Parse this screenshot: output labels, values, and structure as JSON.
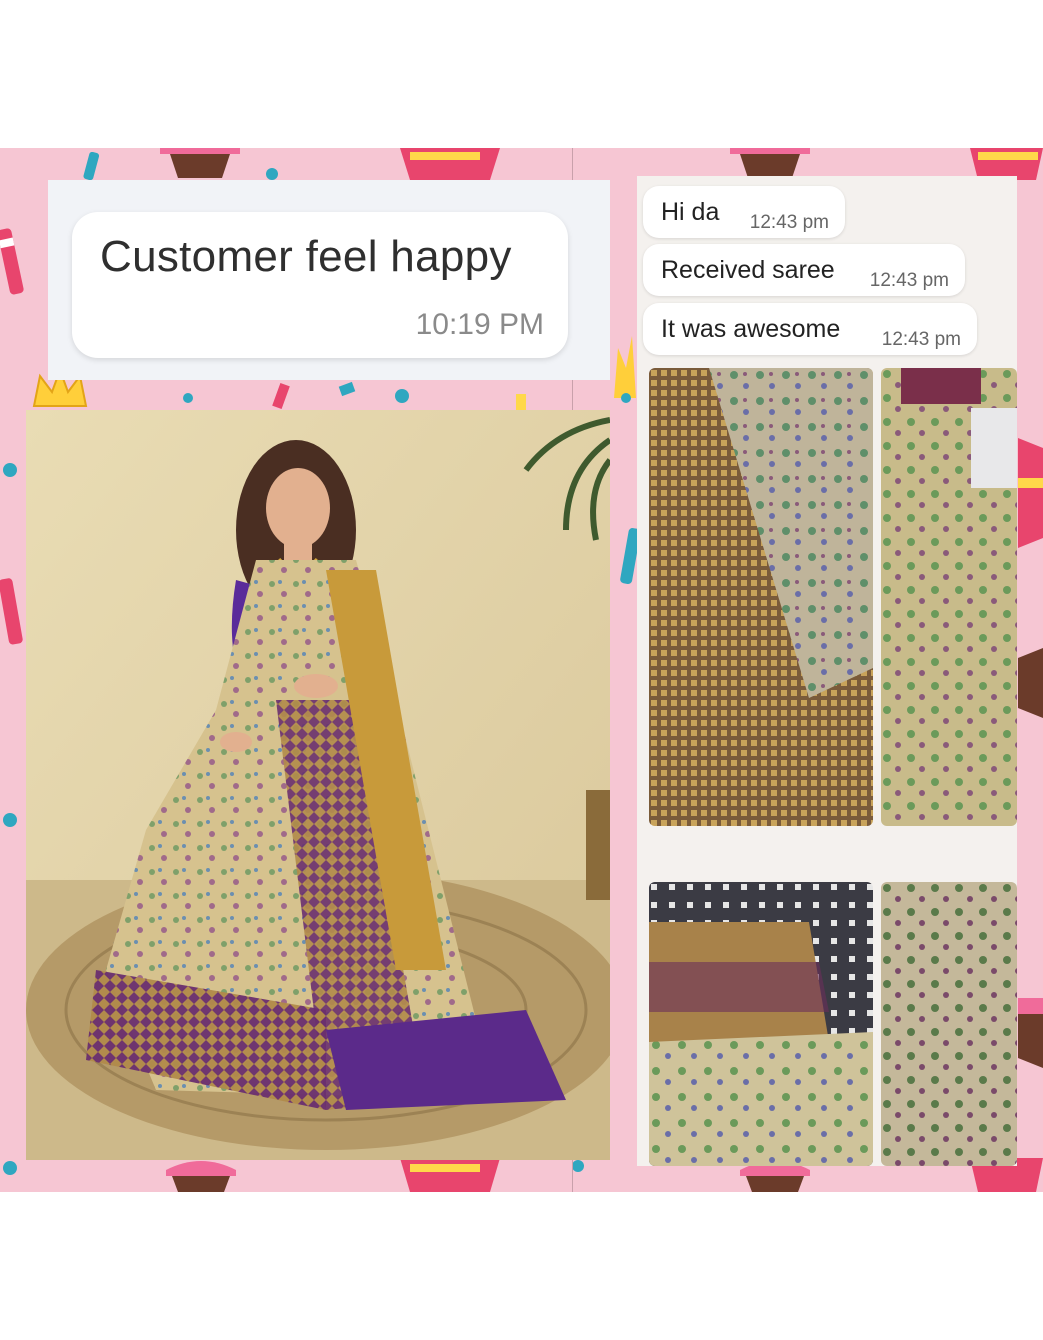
{
  "left_chat": {
    "message": "Customer feel happy",
    "time": "10:19 PM"
  },
  "right_chat": {
    "messages": [
      {
        "text": "Hi da",
        "time": "12:43 pm"
      },
      {
        "text": "Received saree",
        "time": "12:43 pm"
      },
      {
        "text": "It was awesome",
        "time": "12:43 pm"
      }
    ]
  },
  "colors": {
    "background_pink": "#f6c6d3",
    "saree_gold": "#c9aa6a",
    "saree_purple": "#5b2a6e",
    "blouse_purple": "#5a2b9a"
  },
  "icons": [
    "cupcake-sticker",
    "party-hat-sticker",
    "crown-sticker",
    "confetti-dot"
  ]
}
